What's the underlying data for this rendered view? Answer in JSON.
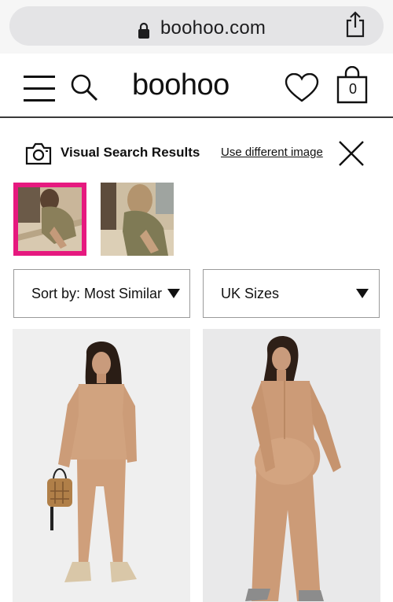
{
  "browser": {
    "url": "boohoo.com"
  },
  "header": {
    "logo": "boohoo",
    "bag_count": "0"
  },
  "visual_search": {
    "title": "Visual Search Results",
    "link": "Use different image"
  },
  "filters": {
    "sort_label": "Sort by: Most Similar",
    "size_label": "UK Sizes"
  },
  "colors": {
    "selected_border": "#e6197f",
    "outfit": "#d2a47f"
  },
  "icons": [
    "lock-icon",
    "share-icon",
    "menu-icon",
    "search-icon",
    "heart-icon",
    "bag-icon",
    "camera-icon",
    "close-icon",
    "dropdown-arrow-icon"
  ]
}
